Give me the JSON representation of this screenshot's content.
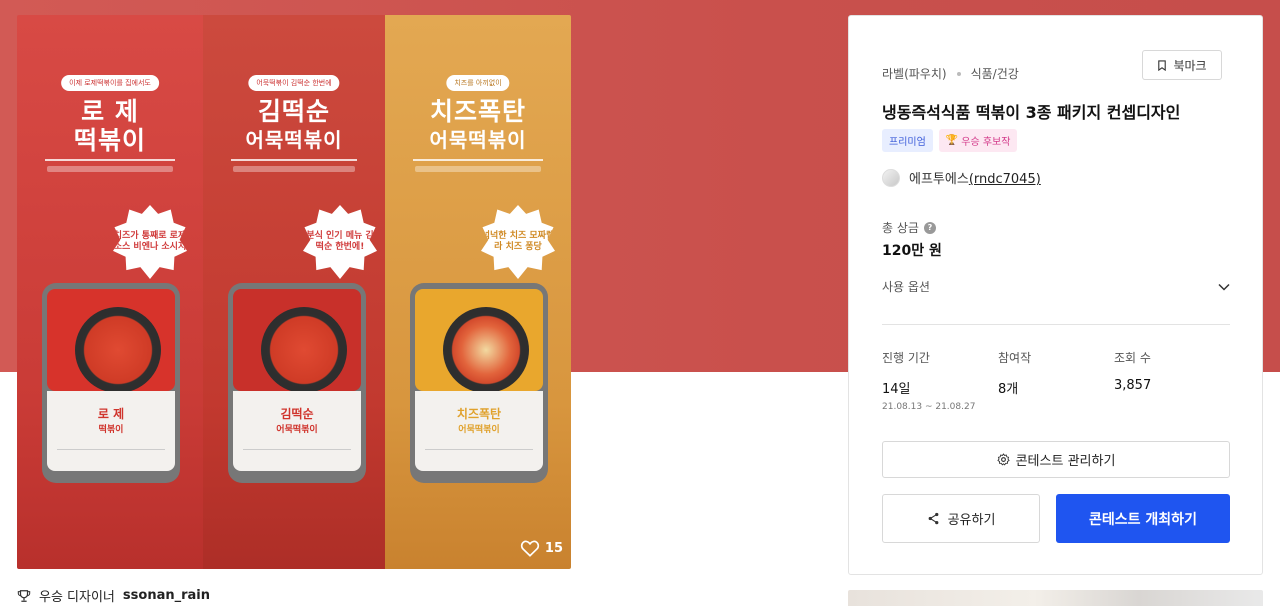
{
  "product": {
    "panels": [
      {
        "badge": "이제 로제떡볶이를 집에서도",
        "title_line1": "로 제",
        "title_line2": "떡볶이",
        "sticker": "치즈가 통째로 로제 소스 비엔나 소시지",
        "package_name": "로 제\n떡볶이"
      },
      {
        "badge": "어묵떡볶이 김떡순 한번에",
        "title_line1": "김떡순",
        "title_line2": "어묵떡볶이",
        "sticker": "분식 인기 메뉴 김떡순 한번에!",
        "package_name": "김떡순\n어묵떡볶이"
      },
      {
        "badge": "치즈를 아끼없이",
        "title_line1": "치즈폭탄",
        "title_line2": "어묵떡볶이",
        "sticker": "넉넉한 치즈 모짜렐라 치즈 퐁당",
        "package_name": "치즈폭탄\n어묵떡볶이"
      }
    ],
    "likes": "15"
  },
  "winner": {
    "label": "우승 디자이너",
    "name": "ssonan_rain"
  },
  "card": {
    "category": "라벨(파우치)",
    "subcategory": "식품/건강",
    "bookmark_label": "북마크",
    "title": "냉동즉석식품 떡볶이 3종 패키지 컨셉디자인",
    "tags": {
      "premium": "프리미엄",
      "award": "우승 후보작"
    },
    "author": {
      "name": "에프투에스",
      "handle": "(rndc7045)"
    },
    "prize_label": "총 상금",
    "prize_value": "120만 원",
    "options_label": "사용 옵션",
    "stats": {
      "period_label": "진행 기간",
      "period_value": "14일",
      "period_range": "21.08.13 ~ 21.08.27",
      "participants_label": "참여작",
      "participants_value": "8개",
      "views_label": "조회 수",
      "views_value": "3,857"
    },
    "manage_label": "콘테스트 관리하기",
    "share_label": "공유하기",
    "host_label": "콘테스트 개최하기"
  },
  "colors": {
    "hero": "#d25a55",
    "primary": "#1f55f0",
    "premium_tag": "#3a5bd9",
    "award_tag": "#d33a8a"
  }
}
